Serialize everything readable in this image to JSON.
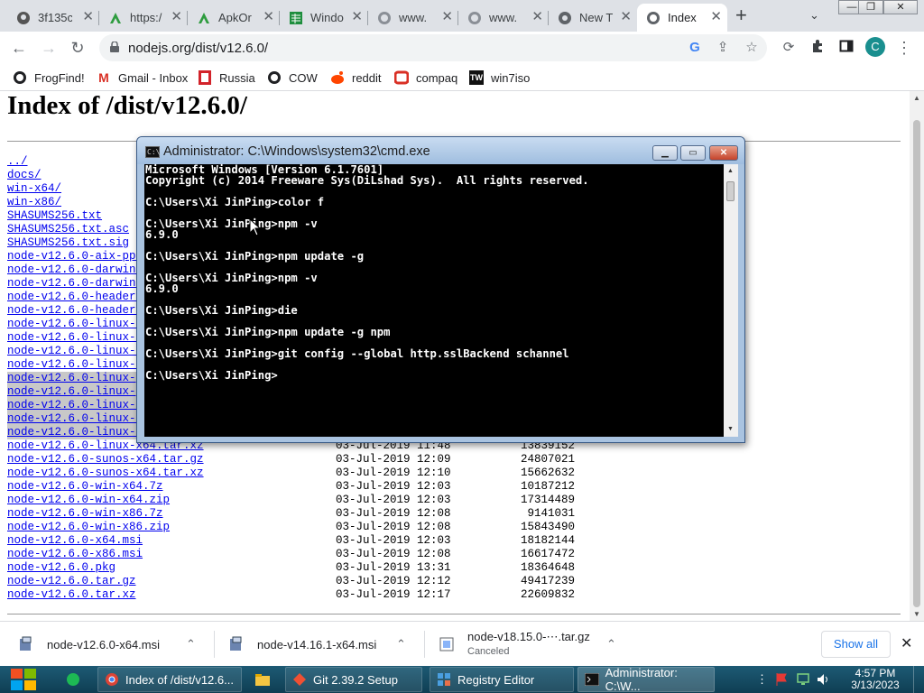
{
  "tabs": [
    {
      "title": "3f135c",
      "icon": "github-icon"
    },
    {
      "title": "https:/",
      "icon": "apk-icon"
    },
    {
      "title": "ApkOr",
      "icon": "apk-icon"
    },
    {
      "title": "Windo",
      "icon": "sheet-icon"
    },
    {
      "title": "www.",
      "icon": "globe-icon"
    },
    {
      "title": "www.",
      "icon": "globe-icon"
    },
    {
      "title": "New T",
      "icon": "chrome-icon"
    },
    {
      "title": "Index",
      "icon": "globe-icon"
    }
  ],
  "window_controls": {
    "minimize": "—",
    "maximize": "❐",
    "close": "✕"
  },
  "toolbar": {
    "url": "nodejs.org/dist/v12.6.0/",
    "avatar_letter": "C",
    "back": "←",
    "forward": "→",
    "reload": "↻",
    "menu": "⋮"
  },
  "bookmarks": [
    {
      "label": "FrogFind!",
      "icon": "globe-icon"
    },
    {
      "label": "Gmail - Inbox",
      "icon": "gmail-icon"
    },
    {
      "label": "Russia",
      "icon": "flag-icon"
    },
    {
      "label": "COW",
      "icon": "globe-icon"
    },
    {
      "label": "reddit",
      "icon": "reddit-icon"
    },
    {
      "label": "compaq",
      "icon": "compaq-icon"
    },
    {
      "label": "win7iso",
      "icon": "win7iso-icon"
    }
  ],
  "page": {
    "heading": "Index of /dist/v12.6.0/",
    "entries": [
      {
        "name": "../",
        "date": "",
        "size": ""
      },
      {
        "name": "docs/",
        "date": "",
        "size": ""
      },
      {
        "name": "win-x64/",
        "date": "",
        "size": ""
      },
      {
        "name": "win-x86/",
        "date": "",
        "size": ""
      },
      {
        "name": "SHASUMS256.txt",
        "date": "",
        "size": ""
      },
      {
        "name": "SHASUMS256.txt.asc",
        "date": "",
        "size": ""
      },
      {
        "name": "SHASUMS256.txt.sig",
        "date": "",
        "size": ""
      },
      {
        "name": "node-v12.6.0-aix-ppc",
        "date": "",
        "size": ""
      },
      {
        "name": "node-v12.6.0-darwin-",
        "date": "",
        "size": ""
      },
      {
        "name": "node-v12.6.0-darwin-",
        "date": "",
        "size": ""
      },
      {
        "name": "node-v12.6.0-headers",
        "date": "",
        "size": ""
      },
      {
        "name": "node-v12.6.0-headers",
        "date": "",
        "size": ""
      },
      {
        "name": "node-v12.6.0-linux-a",
        "date": "",
        "size": ""
      },
      {
        "name": "node-v12.6.0-linux-a",
        "date": "",
        "size": ""
      },
      {
        "name": "node-v12.6.0-linux-a",
        "date": "",
        "size": ""
      },
      {
        "name": "node-v12.6.0-linux-a",
        "date": "",
        "size": ""
      },
      {
        "name": "node-v12.6.0-linux-p",
        "date": "",
        "size": "",
        "selected": true
      },
      {
        "name": "node-v12.6.0-linux-p",
        "date": "",
        "size": "",
        "selected": true
      },
      {
        "name": "node-v12.6.0-linux-s",
        "date": "",
        "size": "",
        "selected": true
      },
      {
        "name": "node-v12.6.0-linux-s",
        "date": "",
        "size": "",
        "selected": true
      },
      {
        "name": "node-v12.6.0-linux-x",
        "date": "",
        "size": "",
        "selected": true
      },
      {
        "name": "node-v12.6.0-linux-x64.tar.xz",
        "date": "03-Jul-2019 11:48",
        "size": "13839152"
      },
      {
        "name": "node-v12.6.0-sunos-x64.tar.gz",
        "date": "03-Jul-2019 12:09",
        "size": "24807021"
      },
      {
        "name": "node-v12.6.0-sunos-x64.tar.xz",
        "date": "03-Jul-2019 12:10",
        "size": "15662632"
      },
      {
        "name": "node-v12.6.0-win-x64.7z",
        "date": "03-Jul-2019 12:03",
        "size": "10187212"
      },
      {
        "name": "node-v12.6.0-win-x64.zip",
        "date": "03-Jul-2019 12:03",
        "size": "17314489"
      },
      {
        "name": "node-v12.6.0-win-x86.7z",
        "date": "03-Jul-2019 12:08",
        "size": "9141031"
      },
      {
        "name": "node-v12.6.0-win-x86.zip",
        "date": "03-Jul-2019 12:08",
        "size": "15843490"
      },
      {
        "name": "node-v12.6.0-x64.msi",
        "date": "03-Jul-2019 12:03",
        "size": "18182144"
      },
      {
        "name": "node-v12.6.0-x86.msi",
        "date": "03-Jul-2019 12:08",
        "size": "16617472"
      },
      {
        "name": "node-v12.6.0.pkg",
        "date": "03-Jul-2019 13:31",
        "size": "18364648"
      },
      {
        "name": "node-v12.6.0.tar.gz",
        "date": "03-Jul-2019 12:12",
        "size": "49417239"
      },
      {
        "name": "node-v12.6.0.tar.xz",
        "date": "03-Jul-2019 12:17",
        "size": "22609832"
      }
    ]
  },
  "cmd": {
    "title": "Administrator: C:\\Windows\\system32\\cmd.exe",
    "icon_text": "C:\\",
    "lines": [
      "Microsoft Windows [Version 6.1.7601]",
      "Copyright (c) 2014 Freeware Sys(DiLshad Sys).  All rights reserved.",
      "",
      "C:\\Users\\Xi JinPing>color f",
      "",
      "C:\\Users\\Xi JinPing>npm -v",
      "6.9.0",
      "",
      "C:\\Users\\Xi JinPing>npm update -g",
      "",
      "C:\\Users\\Xi JinPing>npm -v",
      "6.9.0",
      "",
      "C:\\Users\\Xi JinPing>die",
      "",
      "C:\\Users\\Xi JinPing>npm update -g npm",
      "",
      "C:\\Users\\Xi JinPing>git config --global http.sslBackend schannel",
      "",
      "C:\\Users\\Xi JinPing>"
    ]
  },
  "downloads": [
    {
      "file": "node-v12.6.0-x64.msi",
      "status": ""
    },
    {
      "file": "node-v14.16.1-x64.msi",
      "status": ""
    },
    {
      "file": "node-v18.15.0-⋯.tar.gz",
      "status": "Canceled"
    }
  ],
  "shelf": {
    "show_all": "Show all",
    "close": "✕"
  },
  "taskbar": {
    "apps": [
      {
        "label": "",
        "icon": "app-green-icon"
      },
      {
        "label": "Index of /dist/v12.6...",
        "icon": "chrome-icon"
      },
      {
        "label": "",
        "icon": "folder-icon"
      },
      {
        "label": "Git 2.39.2 Setup",
        "icon": "git-icon"
      },
      {
        "label": "Registry Editor",
        "icon": "regedit-icon"
      },
      {
        "label": "Administrator: C:\\W...",
        "icon": "cmd-icon"
      }
    ],
    "time": "4:57 PM",
    "date": "3/13/2023"
  }
}
